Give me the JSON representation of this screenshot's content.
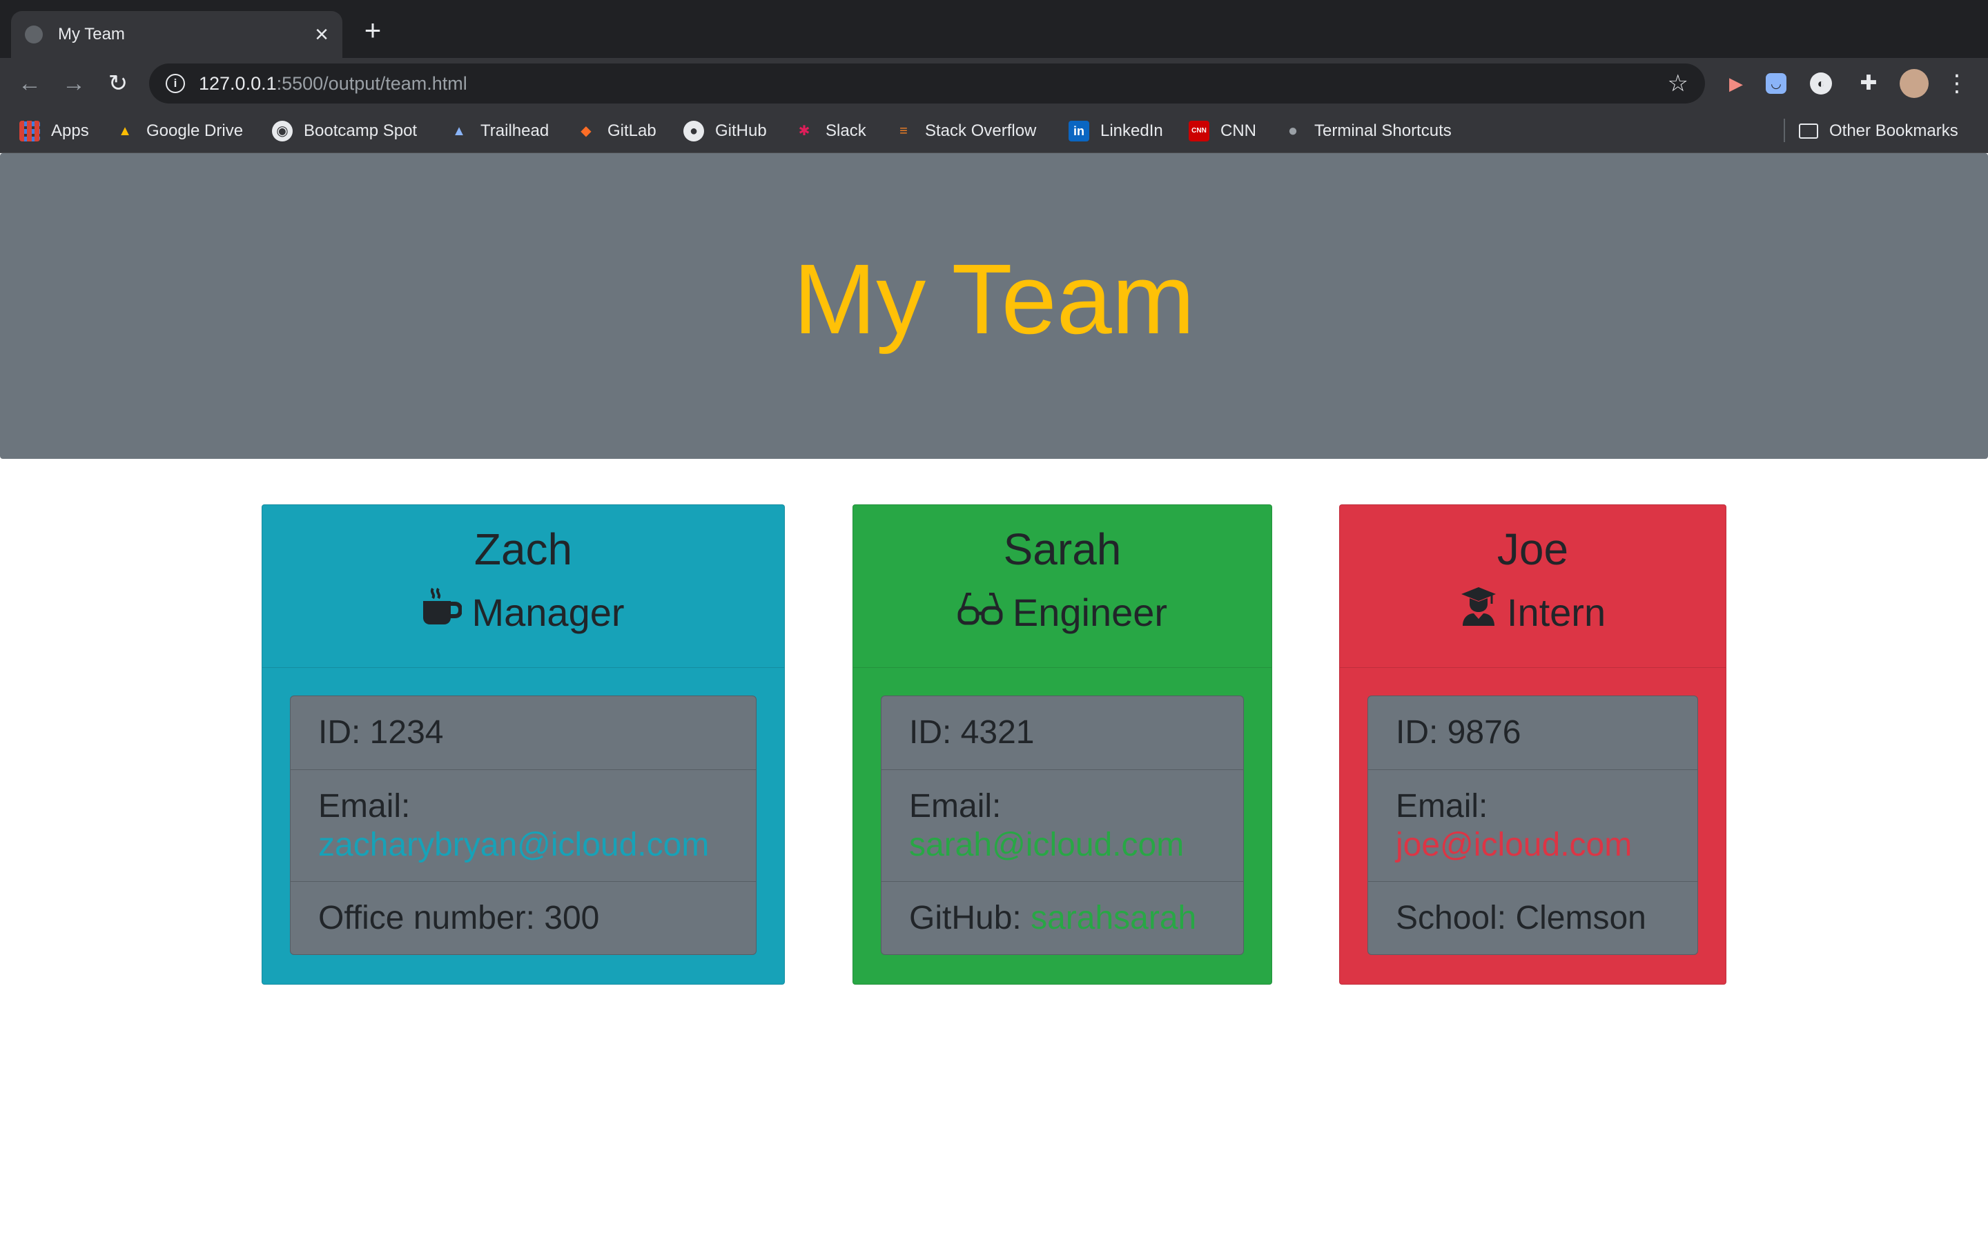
{
  "browser": {
    "tab": {
      "title": "My Team"
    },
    "url": {
      "host": "127.0.0.1",
      "path": ":5500/output/team.html"
    },
    "bookmarks": [
      {
        "label": "Apps",
        "icon": "apps-grid-icon"
      },
      {
        "label": "Google Drive",
        "icon": "google-drive-icon"
      },
      {
        "label": "Bootcamp Spot",
        "icon": "globe-icon"
      },
      {
        "label": "Trailhead",
        "icon": "trailhead-icon"
      },
      {
        "label": "GitLab",
        "icon": "gitlab-icon"
      },
      {
        "label": "GitHub",
        "icon": "github-icon"
      },
      {
        "label": "Slack",
        "icon": "slack-icon"
      },
      {
        "label": "Stack Overflow",
        "icon": "stack-overflow-icon"
      },
      {
        "label": "LinkedIn",
        "icon": "linkedin-icon"
      },
      {
        "label": "CNN",
        "icon": "cnn-icon"
      },
      {
        "label": "Terminal Shortcuts",
        "icon": "apple-icon"
      }
    ],
    "other_bookmarks": "Other Bookmarks"
  },
  "page": {
    "title": "My Team",
    "title_color": "#ffc107",
    "team": [
      {
        "name": "Zach",
        "role": "Manager",
        "role_icon": "coffee-mug-icon",
        "color": "#17a2b8",
        "id_text": "ID: 1234",
        "email_label": "Email:",
        "email": "zacharybryan@icloud.com",
        "extra_label": "Office number: 300"
      },
      {
        "name": "Sarah",
        "role": "Engineer",
        "role_icon": "glasses-icon",
        "color": "#28a745",
        "id_text": "ID: 4321",
        "email_label": "Email:",
        "email": "sarah@icloud.com",
        "extra_label": "GitHub:",
        "extra_link": "sarahsarah"
      },
      {
        "name": "Joe",
        "role": "Intern",
        "role_icon": "graduate-icon",
        "color": "#dc3545",
        "id_text": "ID: 9876",
        "email_label": "Email:",
        "email": "joe@icloud.com",
        "extra_label": "School: Clemson"
      }
    ]
  }
}
